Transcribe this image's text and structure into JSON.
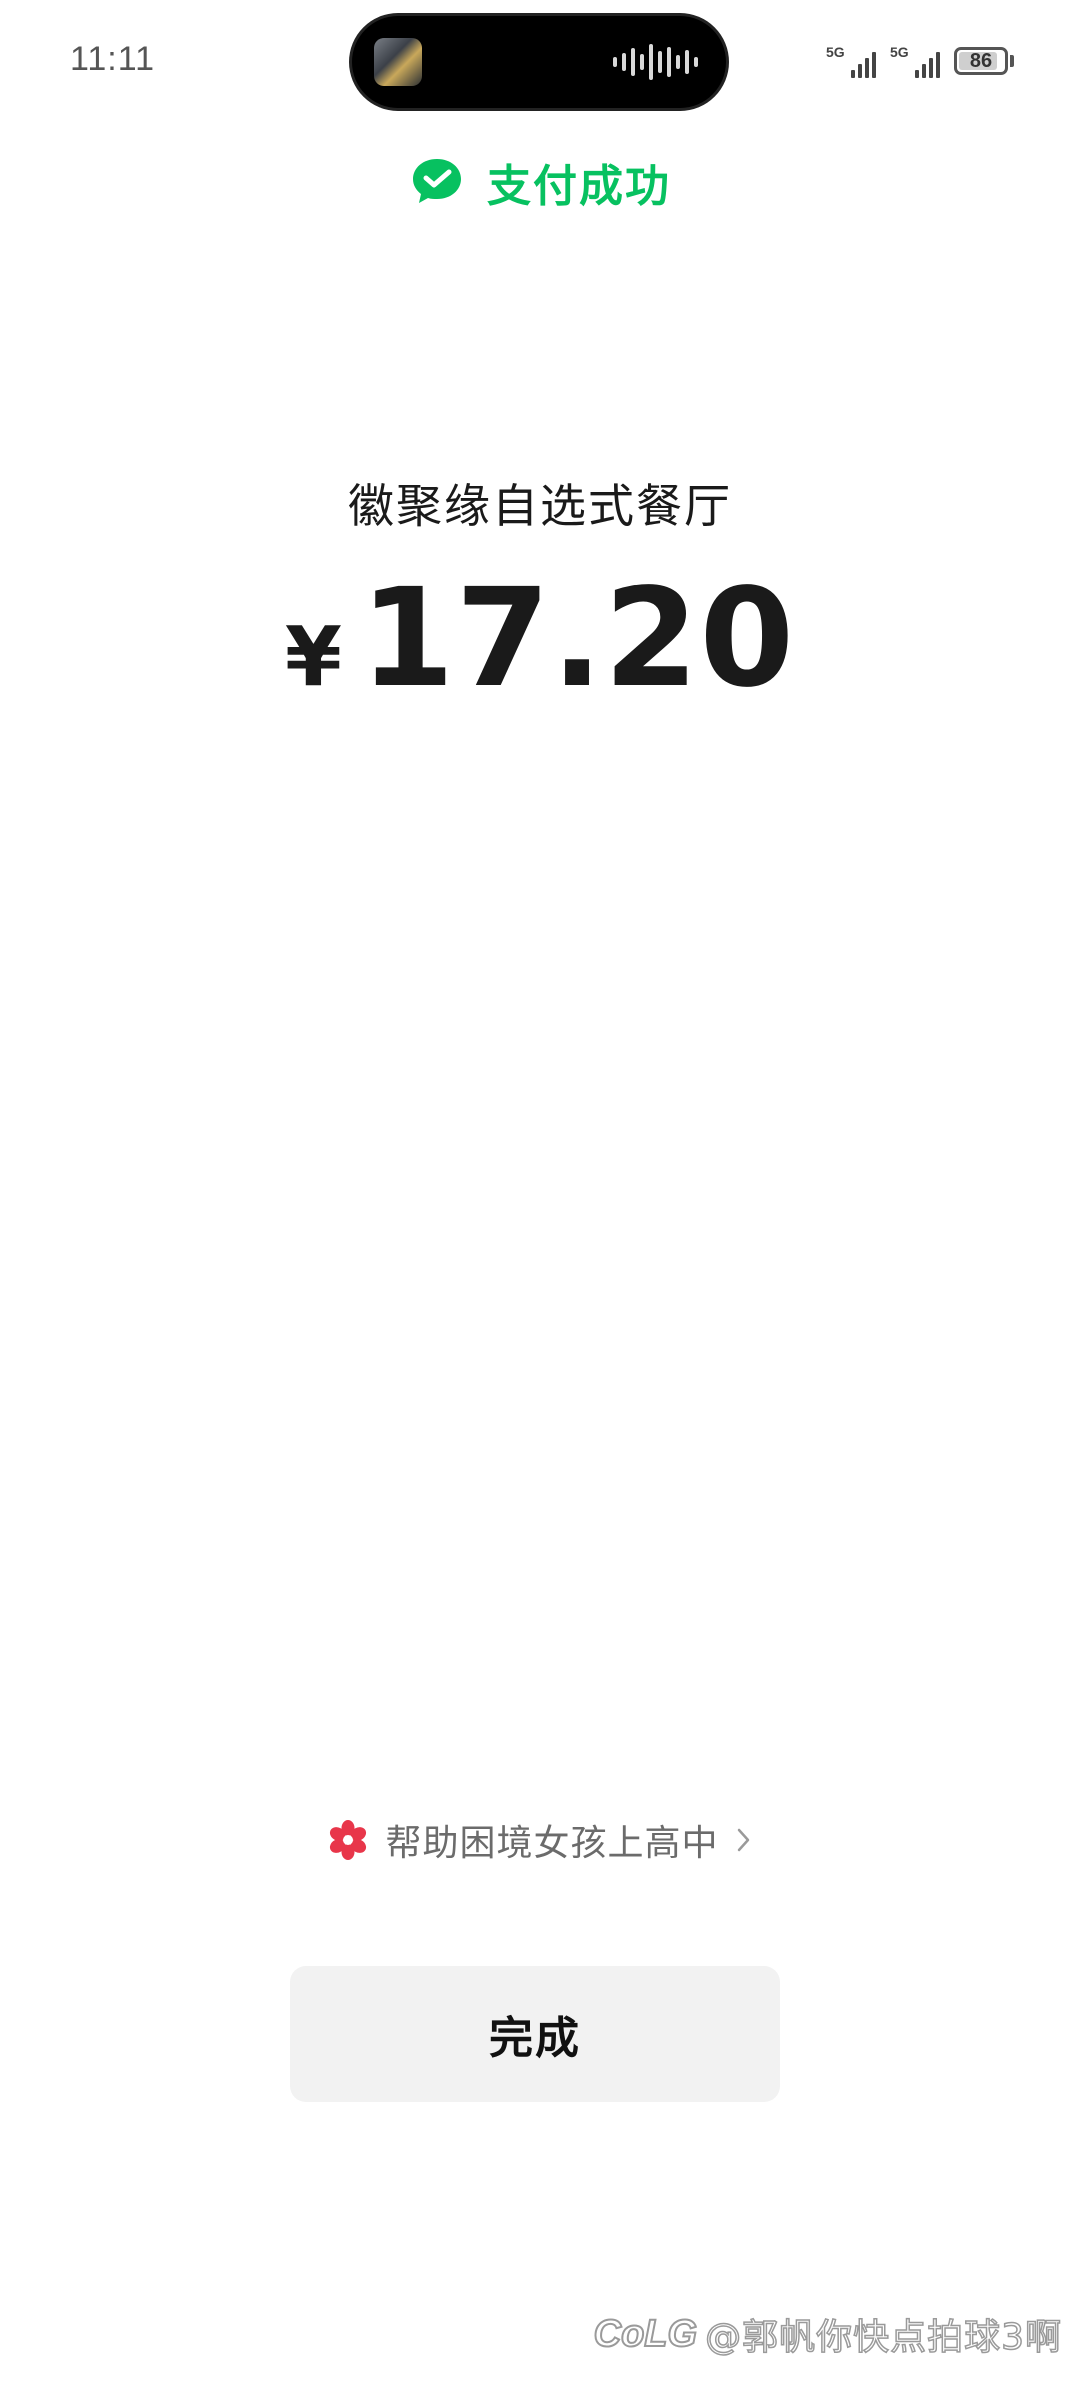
{
  "status_bar": {
    "time": "11:11",
    "network_1": "5G",
    "network_2": "5G",
    "battery_level": "86",
    "battery_fraction": 0.86
  },
  "header": {
    "icon": "wechat-pay-icon",
    "title": "支付成功",
    "accent_color": "#07c160"
  },
  "payment": {
    "merchant": "徽聚缘自选式餐厅",
    "currency_symbol": "¥",
    "amount": "17.20"
  },
  "charity": {
    "icon": "flower-icon",
    "icon_color": "#e8364a",
    "label": "帮助困境女孩上高中"
  },
  "actions": {
    "done_label": "完成"
  },
  "watermark": {
    "logo": "CoLG",
    "text": "@郭帆你快点拍球3啊"
  }
}
